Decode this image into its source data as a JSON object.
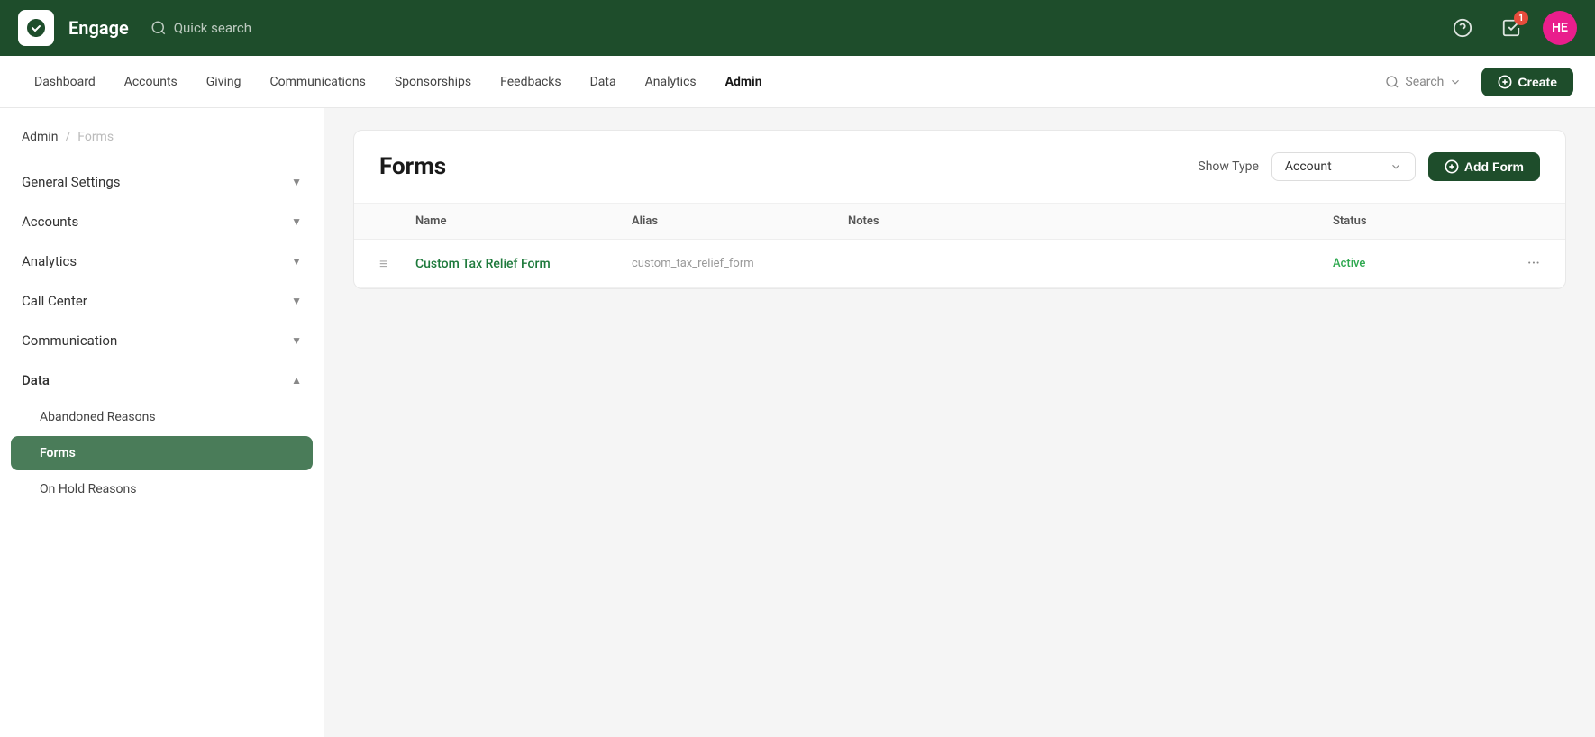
{
  "app": {
    "brand": "Engage",
    "quick_search": "Quick search",
    "avatar_initials": "HE",
    "badge_count": "1"
  },
  "top_nav": {
    "items": [
      {
        "id": "dashboard",
        "label": "Dashboard",
        "active": false
      },
      {
        "id": "accounts",
        "label": "Accounts",
        "active": false
      },
      {
        "id": "giving",
        "label": "Giving",
        "active": false
      },
      {
        "id": "communications",
        "label": "Communications",
        "active": false
      },
      {
        "id": "sponsorships",
        "label": "Sponsorships",
        "active": false
      },
      {
        "id": "feedbacks",
        "label": "Feedbacks",
        "active": false
      },
      {
        "id": "data",
        "label": "Data",
        "active": false
      },
      {
        "id": "analytics",
        "label": "Analytics",
        "active": false
      },
      {
        "id": "admin",
        "label": "Admin",
        "active": true
      }
    ],
    "search_placeholder": "Search",
    "create_label": "Create"
  },
  "breadcrumb": {
    "parent": "Admin",
    "separator": "/",
    "current": "Forms"
  },
  "sidebar": {
    "items": [
      {
        "id": "general-settings",
        "label": "General Settings",
        "expanded": false
      },
      {
        "id": "accounts",
        "label": "Accounts",
        "expanded": false
      },
      {
        "id": "analytics",
        "label": "Analytics",
        "expanded": false
      },
      {
        "id": "call-center",
        "label": "Call Center",
        "expanded": false
      },
      {
        "id": "communication",
        "label": "Communication",
        "expanded": false
      },
      {
        "id": "data",
        "label": "Data",
        "expanded": true
      }
    ],
    "data_sub_items": [
      {
        "id": "abandoned-reasons",
        "label": "Abandoned Reasons",
        "active": false
      },
      {
        "id": "forms",
        "label": "Forms",
        "active": true
      },
      {
        "id": "on-hold-reasons",
        "label": "On Hold Reasons",
        "active": false
      }
    ]
  },
  "forms_panel": {
    "title": "Forms",
    "show_type_label": "Show Type",
    "show_type_value": "Account",
    "add_form_label": "Add Form",
    "table": {
      "columns": [
        {
          "id": "drag",
          "label": ""
        },
        {
          "id": "name",
          "label": "Name"
        },
        {
          "id": "alias",
          "label": "Alias"
        },
        {
          "id": "notes",
          "label": "Notes"
        },
        {
          "id": "status",
          "label": "Status"
        },
        {
          "id": "actions",
          "label": ""
        }
      ],
      "rows": [
        {
          "name": "Custom Tax Relief Form",
          "alias": "custom_tax_relief_form",
          "notes": "",
          "status": "Active"
        }
      ]
    }
  }
}
